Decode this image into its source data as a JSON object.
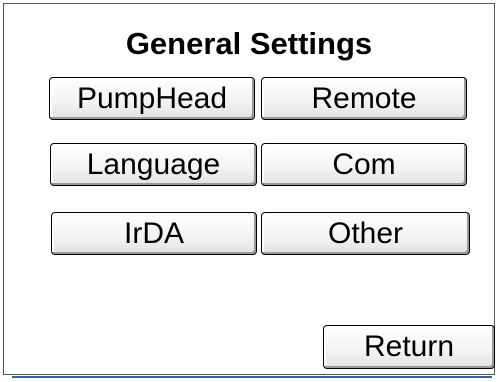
{
  "screen": {
    "title": "General Settings"
  },
  "buttons": {
    "pumphead": "PumpHead",
    "remote": "Remote",
    "language": "Language",
    "com": "Com",
    "irda": "IrDA",
    "other": "Other",
    "return": "Return"
  },
  "colors": {
    "background": "#ffffff",
    "border": "#555555",
    "accent_line": "#3a5fa8"
  }
}
